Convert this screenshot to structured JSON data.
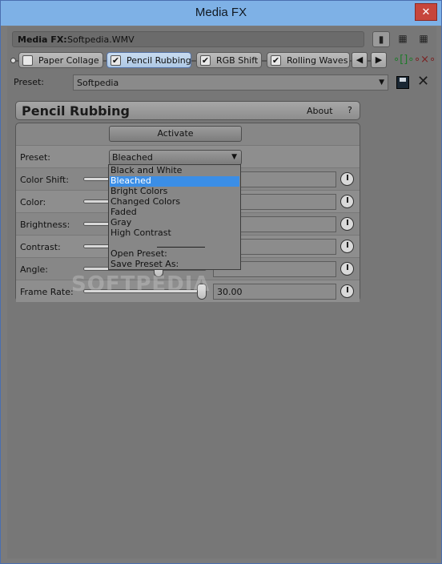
{
  "window": {
    "title": "Media FX",
    "close_label": "✕"
  },
  "media_fx": {
    "label": "Media FX:",
    "file": "Softpedia.WMV"
  },
  "view_buttons": [
    "▮",
    "▦",
    "▦"
  ],
  "fx_chain": {
    "tabs": [
      {
        "label": "Paper Collage",
        "checked": false,
        "check_glyph": ""
      },
      {
        "label": "Pencil Rubbing",
        "checked": true,
        "check_glyph": "✔"
      },
      {
        "label": "RGB Shift",
        "checked": true,
        "check_glyph": "✔"
      },
      {
        "label": "Rolling Waves",
        "checked": true,
        "check_glyph": "✔"
      }
    ],
    "prev_glyph": "◀",
    "next_glyph": "▶",
    "chain_icon": "∘[]∘",
    "remove_chain_icon": "∘×∘"
  },
  "preset_bar": {
    "label": "Preset:",
    "value": "Softpedia",
    "arrow": "▼",
    "delete_glyph": "✕"
  },
  "plugin": {
    "name": "Pencil Rubbing",
    "about": "About",
    "help": "?"
  },
  "panel": {
    "activate": "Activate",
    "preset_label": "Preset:",
    "preset_value": "Bleached",
    "preset_arrow": "▼",
    "params": [
      {
        "label": "Color Shift:",
        "value": ""
      },
      {
        "label": "Color:",
        "value": ""
      },
      {
        "label": "Brightness:",
        "value": ""
      },
      {
        "label": "Contrast:",
        "value": ""
      },
      {
        "label": "Angle:",
        "value": ""
      },
      {
        "label": "Frame Rate:",
        "value": "30.00"
      }
    ],
    "frame_rate_slider": 1.0,
    "angle_slider": 0.62
  },
  "dropdown": {
    "options": [
      "Black and White",
      "Bleached",
      "Bright Colors",
      "Changed Colors",
      "Faded",
      "Gray",
      "High Contrast"
    ],
    "selected": "Bleached",
    "actions": [
      "Open Preset:",
      "Save Preset As:"
    ]
  },
  "watermark": "SOFTPEDIA",
  "colors": {
    "titlebar": "#7eb1e6",
    "selection": "#3b8ee6",
    "background": "#7b7b7b"
  }
}
